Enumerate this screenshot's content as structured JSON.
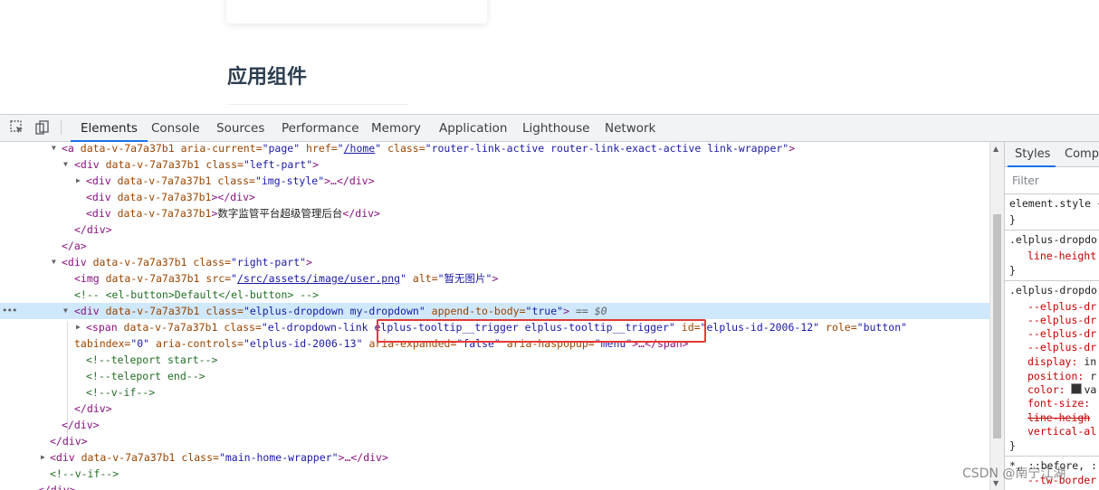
{
  "page": {
    "section_title": "应用组件"
  },
  "devtools": {
    "tabs": [
      {
        "label": "Elements",
        "active": true
      },
      {
        "label": "Console",
        "active": false
      },
      {
        "label": "Sources",
        "active": false
      },
      {
        "label": "Performance",
        "active": false
      },
      {
        "label": "Memory",
        "active": false
      },
      {
        "label": "Application",
        "active": false
      },
      {
        "label": "Lighthouse",
        "active": false
      },
      {
        "label": "Network",
        "active": false
      }
    ],
    "dom": {
      "selected_marker": "== $0",
      "dots": "•••",
      "l1": {
        "tag_open": "<a ",
        "a1": "data-v-7a7a37b1",
        "a2": " aria-current=",
        "v2": "\"page\"",
        "a3": " href=",
        "v3q": "\"",
        "v3": "/home",
        "v3e": "\"",
        "a4": " class=",
        "v4": "\"router-link-active router-link-exact-active link-wrapper\"",
        "close": ">"
      },
      "l2": {
        "tag_open": "<div ",
        "a1": "data-v-7a7a37b1",
        "a2": " class=",
        "v2": "\"left-part\"",
        "close": ">"
      },
      "l3": {
        "tag_open": "<div ",
        "a1": "data-v-7a7a37b1",
        "a2": " class=",
        "v2": "\"img-style\"",
        "close": ">…</div>"
      },
      "l4": {
        "tag_open": "<div ",
        "a1": "data-v-7a7a37b1",
        "close": "></div>"
      },
      "l5": {
        "tag_open": "<div ",
        "a1": "data-v-7a7a37b1",
        "close": ">",
        "text": "数字监管平台超级管理后台",
        "end": "</div>"
      },
      "l6": "</div>",
      "l7": "</a>",
      "l8": {
        "tag_open": "<div ",
        "a1": "data-v-7a7a37b1",
        "a2": " class=",
        "v2": "\"right-part\"",
        "close": ">"
      },
      "l9": {
        "tag_open": "<img ",
        "a1": "data-v-7a7a37b1",
        "a2": " src=",
        "v2q": "\"",
        "v2": "/src/assets/image/user.png",
        "v2e": "\"",
        "a3": " alt=",
        "v3": "\"暂无图片\"",
        "close": ">"
      },
      "l10": "<!-- <el-button>Default</el-button> -->",
      "l11": {
        "tag_open": "<div ",
        "a1": "data-v-7a7a37b1",
        "a2": " class=",
        "v2": "\"elplus-dropdown my-dropdown\"",
        "a3": " append-to-body=",
        "v3": "\"true\"",
        "close": ">"
      },
      "l12": {
        "tag_open": "<span ",
        "a1": "data-v-7a7a37b1",
        "a2": " class=",
        "v2": "\"el-dropdown-link elplus-tooltip__trigger elplus-tooltip__trigger\"",
        "a3": " id=",
        "v3": "\"elplus-id-2006-12\"",
        "a4": " role=",
        "v4": "\"button\""
      },
      "l13": {
        "a1": "tabindex=",
        "v1": "\"0\"",
        "a2": " aria-controls=",
        "v2": "\"elplus-id-2006-13\"",
        "a3": " aria-expanded=",
        "v3": "\"false\"",
        "a4": " aria-haspopup=",
        "v4": "\"menu\"",
        "close": ">…</span>"
      },
      "l14": "<!--teleport start-->",
      "l15": "<!--teleport end-->",
      "l16": "<!--v-if-->",
      "l17": "</div>",
      "l18": "</div>",
      "l19": "</div>",
      "l20": {
        "tag_open": "<div ",
        "a1": "data-v-7a7a37b1",
        "a2": " class=",
        "v2": "\"main-home-wrapper\"",
        "close": ">…</div>"
      },
      "l21": "<!--v-if-->",
      "l22": "</div>"
    },
    "styles_pane": {
      "tabs": [
        {
          "label": "Styles",
          "active": true
        },
        {
          "label": "Compu",
          "active": false
        }
      ],
      "filter_placeholder": "Filter",
      "rules": {
        "r1_selector": "element.style {",
        "r1_close": "}",
        "r2_selector": ".elplus-dropdo",
        "r2_p1": "line-height",
        "r2_close": "}",
        "r3_selector": ".elplus-dropdo",
        "r3_p1": "--elplus-dr",
        "r3_p2": "--elplus-dr",
        "r3_p3": "--elplus-dr",
        "r3_p4": "--elplus-dr",
        "r3_p5_name": "display:",
        "r3_p5_val": " in",
        "r3_p6_name": "position:",
        "r3_p6_val": " r",
        "r3_p7_name": "color:",
        "r3_p7_val": "va",
        "r3_p8_name": "font-size:",
        "r3_p9": "line-heigh",
        "r3_p10_name": "vertical-al",
        "r3_close": "}",
        "r4_selector": "*, ::before, :",
        "r4_p1": "--tw-border"
      }
    }
  },
  "watermark": "CSDN @南宁江湖",
  "colors": {
    "highlight_box": "#e53935",
    "selected_row": "#cfe8fc",
    "active_tab_underline": "#1a73e8"
  }
}
